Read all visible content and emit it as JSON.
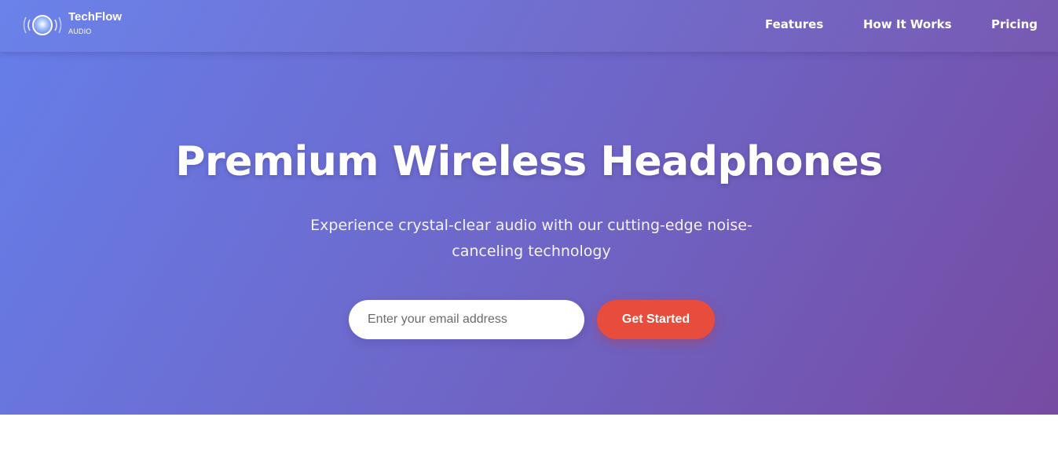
{
  "brand": {
    "name": "TechFlow",
    "tagline": "AUDIO",
    "logo_icon": "sound-wave-orb-icon"
  },
  "nav": {
    "items": [
      {
        "label": "Features"
      },
      {
        "label": "How It Works"
      },
      {
        "label": "Pricing"
      }
    ]
  },
  "hero": {
    "title": "Premium Wireless Headphones",
    "subtitle": "Experience crystal-clear audio with our cutting-edge noise-canceling technology",
    "email_placeholder": "Enter your email address",
    "email_value": "",
    "cta_label": "Get Started"
  },
  "colors": {
    "gradient_start": "#667eea",
    "gradient_end": "#764ba2",
    "cta": "#e74c3c",
    "text": "#ffffff"
  }
}
